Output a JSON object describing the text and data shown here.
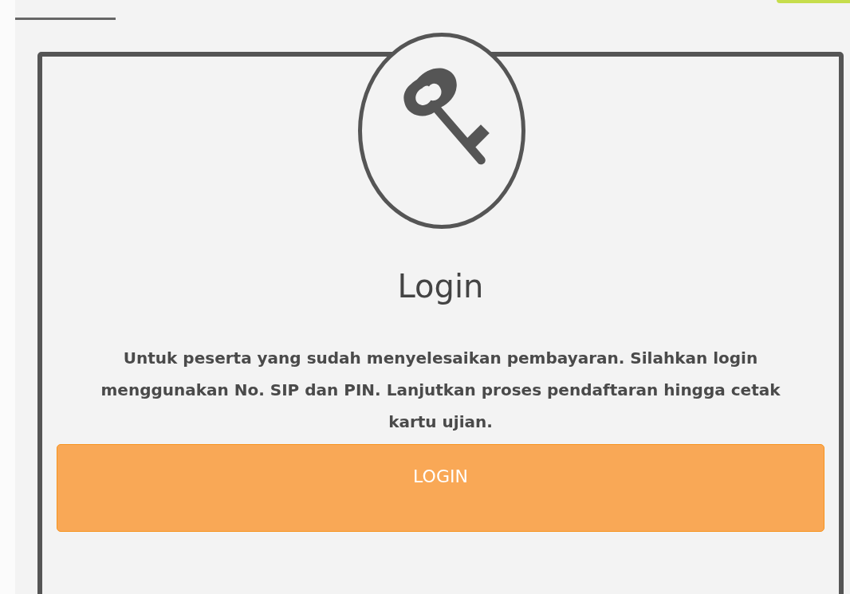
{
  "login_card": {
    "title": "Login",
    "description": "Untuk peserta yang sudah menyelesaikan pembayaran. Silahkan login menggunakan No. SIP dan PIN. Lanjutkan proses pendaftaran hingga cetak kartu ujian.",
    "button": "LOGIN"
  }
}
